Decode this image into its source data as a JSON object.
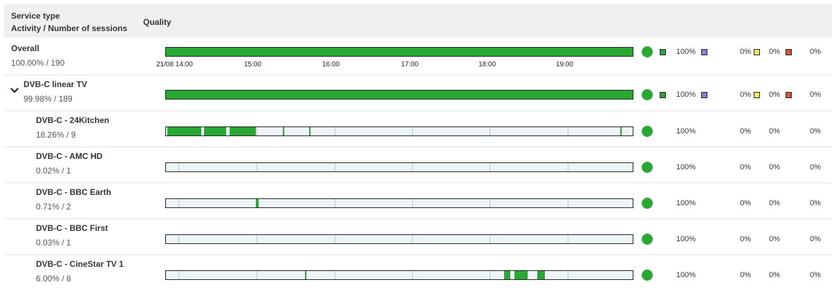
{
  "header": {
    "service_type": "Service type",
    "activity": "Activity / Number of sessions",
    "quality": "Quality"
  },
  "axis": [
    "21/08 14:00",
    "15:00",
    "16:00",
    "17:00",
    "18:00",
    "19:00"
  ],
  "colors": {
    "good": "#2aa834",
    "purple": "#8a7be6",
    "yellow": "#f4ea55",
    "red": "#e0532e"
  },
  "rows": [
    {
      "name": "Overall",
      "stat": "100.00% / 190",
      "p1": "100%",
      "p2": "0%",
      "p3": "0%",
      "p4": "0%",
      "full_bar": true,
      "legend_squares": true
    },
    {
      "name": "DVB-C linear TV",
      "stat": "99.98% / 189",
      "p1": "100%",
      "p2": "0%",
      "p3": "0%",
      "p4": "0%",
      "full_bar": true,
      "legend_squares": true,
      "expanded": true
    },
    {
      "name": "DVB-C - 24Kitchen",
      "stat": "18.26% / 9",
      "p1": "100%",
      "p2": "0%",
      "p3": "0%",
      "p4": "0%",
      "segments": [
        [
          0.003,
          0.075
        ],
        [
          0.082,
          0.13
        ],
        [
          0.136,
          0.192
        ],
        [
          0.25,
          0.252
        ],
        [
          0.306,
          0.308
        ],
        [
          0.974,
          0.976
        ]
      ]
    },
    {
      "name": "DVB-C - AMC HD",
      "stat": "0.02% / 1",
      "p1": "100%",
      "p2": "0%",
      "p3": "0%",
      "p4": "0%",
      "segments": []
    },
    {
      "name": "DVB-C - BBC Earth",
      "stat": "0.71% / 2",
      "p1": "100%",
      "p2": "0%",
      "p3": "0%",
      "p4": "0%",
      "segments": [
        [
          0.193,
          0.199
        ]
      ]
    },
    {
      "name": "DVB-C - BBC First",
      "stat": "0.03% / 1",
      "p1": "100%",
      "p2": "0%",
      "p3": "0%",
      "p4": "0%",
      "segments": []
    },
    {
      "name": "DVB-C - CineStar TV 1",
      "stat": "6.00% / 8",
      "p1": "100%",
      "p2": "0%",
      "p3": "0%",
      "p4": "0%",
      "segments": [
        [
          0.298,
          0.301
        ],
        [
          0.724,
          0.738
        ],
        [
          0.746,
          0.774
        ],
        [
          0.796,
          0.813
        ]
      ]
    }
  ]
}
